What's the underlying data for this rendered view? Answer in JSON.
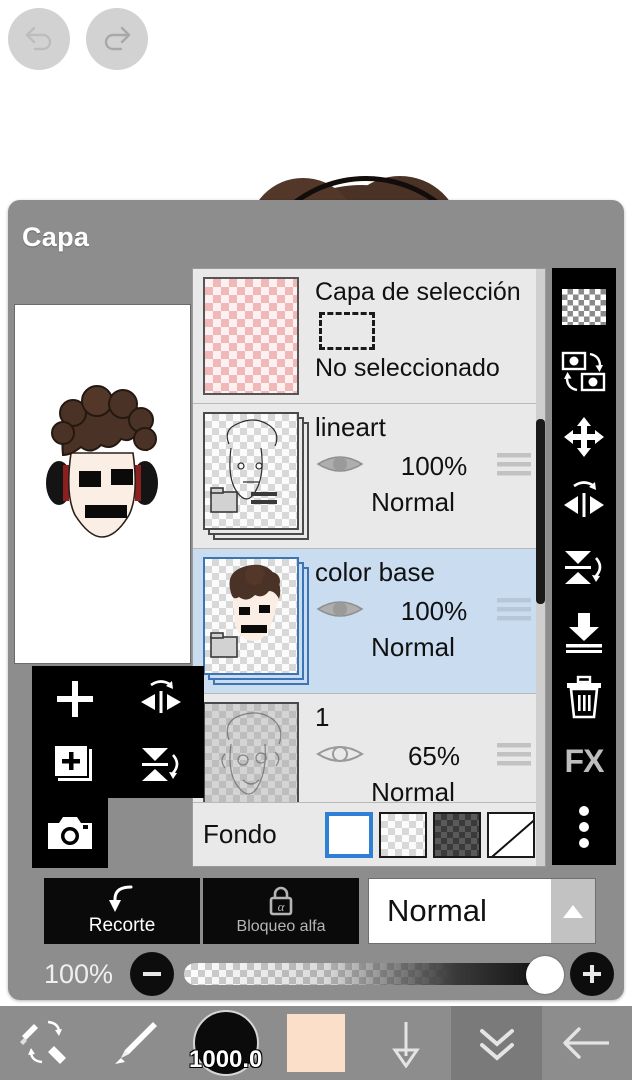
{
  "app": {
    "panel_title": "Capa"
  },
  "top_nav": {
    "undo": "undo-icon",
    "redo": "redo-icon"
  },
  "selection_layer": {
    "title": "Capa de selección",
    "state": "No seleccionado",
    "icon": "marquee-icon"
  },
  "layers": [
    {
      "name": "lineart",
      "opacity": "100%",
      "blend": "Normal",
      "visible": true,
      "selected": false,
      "is_folder": true
    },
    {
      "name": "color base",
      "opacity": "100%",
      "blend": "Normal",
      "visible": true,
      "selected": true,
      "is_folder": true
    },
    {
      "name": "1",
      "opacity": "65%",
      "blend": "Normal",
      "visible": false,
      "selected": false,
      "is_folder": false
    }
  ],
  "background_row": {
    "label": "Fondo",
    "swatches": [
      {
        "name": "white",
        "type": "solid",
        "selected": true
      },
      {
        "name": "light-checker",
        "type": "checker-light",
        "selected": false
      },
      {
        "name": "dark-checker",
        "type": "checker-dark",
        "selected": false
      },
      {
        "name": "none",
        "type": "diagonal",
        "selected": false
      }
    ]
  },
  "right_toolbar": [
    {
      "icon": "transparency-checker-icon",
      "label": ""
    },
    {
      "icon": "swap-layers-icon",
      "label": ""
    },
    {
      "icon": "move-icon",
      "label": ""
    },
    {
      "icon": "flip-horizontal-icon",
      "label": ""
    },
    {
      "icon": "flip-vertical-icon",
      "label": ""
    },
    {
      "icon": "merge-down-icon",
      "label": ""
    },
    {
      "icon": "trash-icon",
      "label": ""
    },
    {
      "icon": "fx-icon",
      "label": "FX"
    },
    {
      "icon": "more-options-icon",
      "label": ""
    }
  ],
  "left_toolbar": [
    {
      "icon": "add-layer-icon"
    },
    {
      "icon": "flip-horizontal-icon"
    },
    {
      "icon": "duplicate-layer-icon"
    },
    {
      "icon": "flip-vertical-icon"
    },
    {
      "icon": "camera-icon"
    }
  ],
  "controls": {
    "clipping": {
      "label": "Recorte",
      "icon": "clipping-arrow-icon"
    },
    "alpha_lock": {
      "label": "Bloqueo alfa",
      "icon": "alpha-lock-icon"
    },
    "blend_mode": {
      "value": "Normal",
      "arrow": "chevron-up-icon"
    }
  },
  "opacity": {
    "value": "100%",
    "minus": "minus-icon",
    "plus": "plus-icon",
    "percent": 100
  },
  "bottom_bar": {
    "items": [
      {
        "icon": "brush-eraser-swap-icon"
      },
      {
        "icon": "brush-icon"
      },
      {
        "icon": "brush-size-icon",
        "size": "1000.0"
      },
      {
        "icon": "color-swatch-icon",
        "color": "#fbdfc9"
      },
      {
        "icon": "arrow-down-icon"
      },
      {
        "icon": "double-chevron-down-icon"
      },
      {
        "icon": "back-arrow-icon"
      }
    ]
  },
  "colors": {
    "panel_bg": "#8d8d8d",
    "list_bg": "#e9e9e9",
    "selected_row": "#c9dcf0",
    "accent_blue": "#3c74b4",
    "toolbar_black": "#000000",
    "swatch_peach": "#fbdfc9",
    "hair_brown": "#4a3226"
  }
}
